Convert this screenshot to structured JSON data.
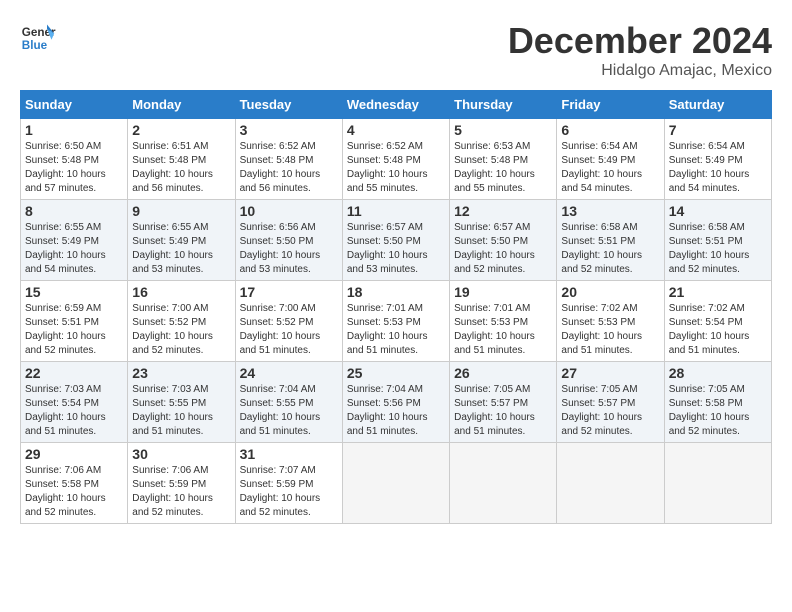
{
  "logo": {
    "line1": "General",
    "line2": "Blue"
  },
  "title": "December 2024",
  "location": "Hidalgo Amajac, Mexico",
  "days_of_week": [
    "Sunday",
    "Monday",
    "Tuesday",
    "Wednesday",
    "Thursday",
    "Friday",
    "Saturday"
  ],
  "weeks": [
    [
      {
        "day": "1",
        "info": "Sunrise: 6:50 AM\nSunset: 5:48 PM\nDaylight: 10 hours\nand 57 minutes."
      },
      {
        "day": "2",
        "info": "Sunrise: 6:51 AM\nSunset: 5:48 PM\nDaylight: 10 hours\nand 56 minutes."
      },
      {
        "day": "3",
        "info": "Sunrise: 6:52 AM\nSunset: 5:48 PM\nDaylight: 10 hours\nand 56 minutes."
      },
      {
        "day": "4",
        "info": "Sunrise: 6:52 AM\nSunset: 5:48 PM\nDaylight: 10 hours\nand 55 minutes."
      },
      {
        "day": "5",
        "info": "Sunrise: 6:53 AM\nSunset: 5:48 PM\nDaylight: 10 hours\nand 55 minutes."
      },
      {
        "day": "6",
        "info": "Sunrise: 6:54 AM\nSunset: 5:49 PM\nDaylight: 10 hours\nand 54 minutes."
      },
      {
        "day": "7",
        "info": "Sunrise: 6:54 AM\nSunset: 5:49 PM\nDaylight: 10 hours\nand 54 minutes."
      }
    ],
    [
      {
        "day": "8",
        "info": "Sunrise: 6:55 AM\nSunset: 5:49 PM\nDaylight: 10 hours\nand 54 minutes."
      },
      {
        "day": "9",
        "info": "Sunrise: 6:55 AM\nSunset: 5:49 PM\nDaylight: 10 hours\nand 53 minutes."
      },
      {
        "day": "10",
        "info": "Sunrise: 6:56 AM\nSunset: 5:50 PM\nDaylight: 10 hours\nand 53 minutes."
      },
      {
        "day": "11",
        "info": "Sunrise: 6:57 AM\nSunset: 5:50 PM\nDaylight: 10 hours\nand 53 minutes."
      },
      {
        "day": "12",
        "info": "Sunrise: 6:57 AM\nSunset: 5:50 PM\nDaylight: 10 hours\nand 52 minutes."
      },
      {
        "day": "13",
        "info": "Sunrise: 6:58 AM\nSunset: 5:51 PM\nDaylight: 10 hours\nand 52 minutes."
      },
      {
        "day": "14",
        "info": "Sunrise: 6:58 AM\nSunset: 5:51 PM\nDaylight: 10 hours\nand 52 minutes."
      }
    ],
    [
      {
        "day": "15",
        "info": "Sunrise: 6:59 AM\nSunset: 5:51 PM\nDaylight: 10 hours\nand 52 minutes."
      },
      {
        "day": "16",
        "info": "Sunrise: 7:00 AM\nSunset: 5:52 PM\nDaylight: 10 hours\nand 52 minutes."
      },
      {
        "day": "17",
        "info": "Sunrise: 7:00 AM\nSunset: 5:52 PM\nDaylight: 10 hours\nand 51 minutes."
      },
      {
        "day": "18",
        "info": "Sunrise: 7:01 AM\nSunset: 5:53 PM\nDaylight: 10 hours\nand 51 minutes."
      },
      {
        "day": "19",
        "info": "Sunrise: 7:01 AM\nSunset: 5:53 PM\nDaylight: 10 hours\nand 51 minutes."
      },
      {
        "day": "20",
        "info": "Sunrise: 7:02 AM\nSunset: 5:53 PM\nDaylight: 10 hours\nand 51 minutes."
      },
      {
        "day": "21",
        "info": "Sunrise: 7:02 AM\nSunset: 5:54 PM\nDaylight: 10 hours\nand 51 minutes."
      }
    ],
    [
      {
        "day": "22",
        "info": "Sunrise: 7:03 AM\nSunset: 5:54 PM\nDaylight: 10 hours\nand 51 minutes."
      },
      {
        "day": "23",
        "info": "Sunrise: 7:03 AM\nSunset: 5:55 PM\nDaylight: 10 hours\nand 51 minutes."
      },
      {
        "day": "24",
        "info": "Sunrise: 7:04 AM\nSunset: 5:55 PM\nDaylight: 10 hours\nand 51 minutes."
      },
      {
        "day": "25",
        "info": "Sunrise: 7:04 AM\nSunset: 5:56 PM\nDaylight: 10 hours\nand 51 minutes."
      },
      {
        "day": "26",
        "info": "Sunrise: 7:05 AM\nSunset: 5:57 PM\nDaylight: 10 hours\nand 51 minutes."
      },
      {
        "day": "27",
        "info": "Sunrise: 7:05 AM\nSunset: 5:57 PM\nDaylight: 10 hours\nand 52 minutes."
      },
      {
        "day": "28",
        "info": "Sunrise: 7:05 AM\nSunset: 5:58 PM\nDaylight: 10 hours\nand 52 minutes."
      }
    ],
    [
      {
        "day": "29",
        "info": "Sunrise: 7:06 AM\nSunset: 5:58 PM\nDaylight: 10 hours\nand 52 minutes."
      },
      {
        "day": "30",
        "info": "Sunrise: 7:06 AM\nSunset: 5:59 PM\nDaylight: 10 hours\nand 52 minutes."
      },
      {
        "day": "31",
        "info": "Sunrise: 7:07 AM\nSunset: 5:59 PM\nDaylight: 10 hours\nand 52 minutes."
      },
      null,
      null,
      null,
      null
    ]
  ]
}
